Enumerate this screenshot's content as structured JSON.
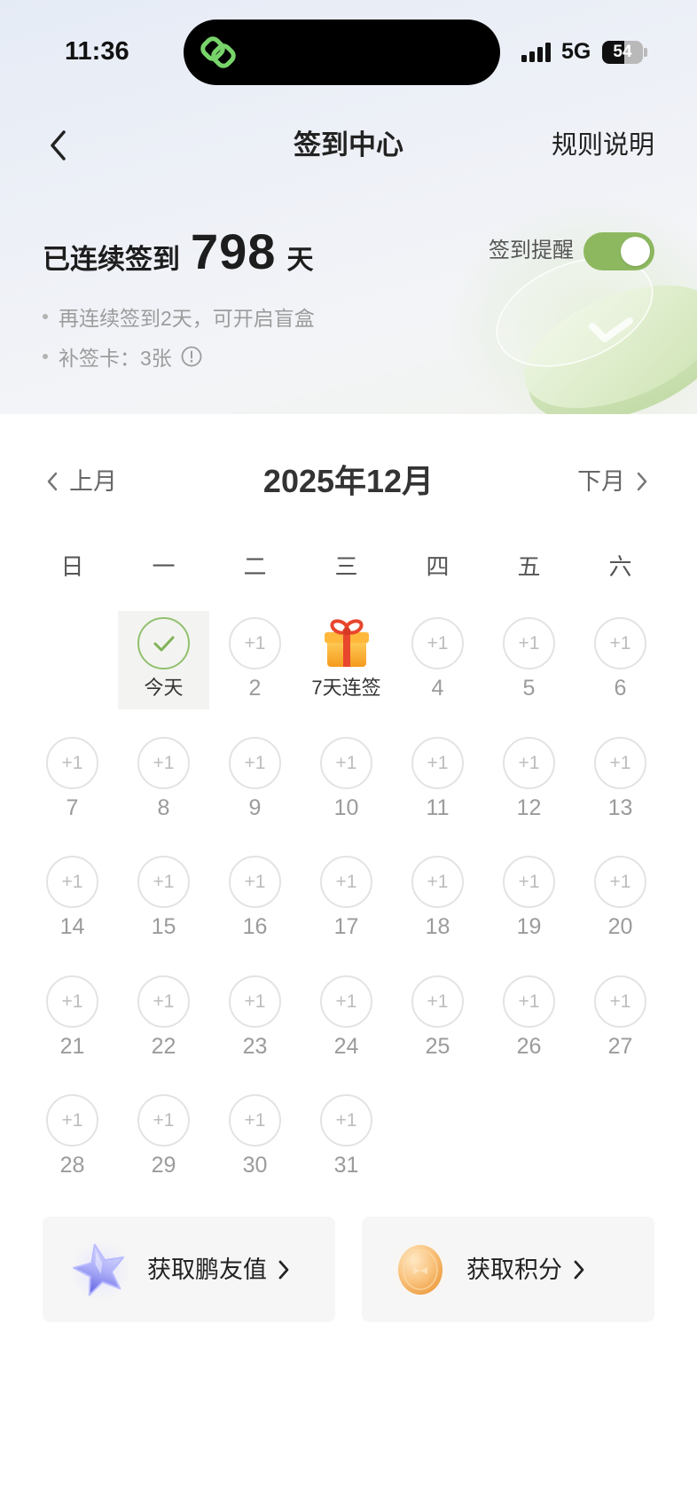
{
  "status_bar": {
    "time": "11:36",
    "island_icon": "link-icon",
    "signal_icon": "signal-icon",
    "network": "5G",
    "battery": "54"
  },
  "header": {
    "back_icon": "chevron-left-icon",
    "title": "签到中心",
    "rules_label": "规则说明"
  },
  "streak": {
    "prefix": "已连续签到",
    "days": "798",
    "suffix": "天"
  },
  "reminder": {
    "label": "签到提醒",
    "enabled": true
  },
  "tips": [
    {
      "text": "再连续签到2天，可开启盲盒"
    },
    {
      "text": "补签卡：3张",
      "icon": "info-icon"
    }
  ],
  "calendar": {
    "prev_label": "上月",
    "title": "2025年12月",
    "next_label": "下月",
    "weekdays": [
      "日",
      "一",
      "二",
      "三",
      "四",
      "五",
      "六"
    ],
    "weeks": [
      [
        null,
        {
          "label": "今天",
          "today": true,
          "signed": true,
          "icon": "check-icon"
        },
        {
          "label": "2",
          "reward": "+1"
        },
        {
          "label": "7天连签",
          "icon": "gift-icon"
        },
        {
          "label": "4",
          "reward": "+1"
        },
        {
          "label": "5",
          "reward": "+1"
        },
        {
          "label": "6",
          "reward": "+1"
        }
      ],
      [
        {
          "label": "7",
          "reward": "+1"
        },
        {
          "label": "8",
          "reward": "+1"
        },
        {
          "label": "9",
          "reward": "+1"
        },
        {
          "label": "10",
          "reward": "+1"
        },
        {
          "label": "11",
          "reward": "+1"
        },
        {
          "label": "12",
          "reward": "+1"
        },
        {
          "label": "13",
          "reward": "+1"
        }
      ],
      [
        {
          "label": "14",
          "reward": "+1"
        },
        {
          "label": "15",
          "reward": "+1"
        },
        {
          "label": "16",
          "reward": "+1"
        },
        {
          "label": "17",
          "reward": "+1"
        },
        {
          "label": "18",
          "reward": "+1"
        },
        {
          "label": "19",
          "reward": "+1"
        },
        {
          "label": "20",
          "reward": "+1"
        }
      ],
      [
        {
          "label": "21",
          "reward": "+1"
        },
        {
          "label": "22",
          "reward": "+1"
        },
        {
          "label": "23",
          "reward": "+1"
        },
        {
          "label": "24",
          "reward": "+1"
        },
        {
          "label": "25",
          "reward": "+1"
        },
        {
          "label": "26",
          "reward": "+1"
        },
        {
          "label": "27",
          "reward": "+1"
        }
      ],
      [
        {
          "label": "28",
          "reward": "+1"
        },
        {
          "label": "29",
          "reward": "+1"
        },
        {
          "label": "30",
          "reward": "+1"
        },
        {
          "label": "31",
          "reward": "+1"
        },
        null,
        null,
        null
      ]
    ]
  },
  "cards": [
    {
      "label": "获取鹏友值",
      "icon": "star-icon"
    },
    {
      "label": "获取积分",
      "icon": "coin-icon"
    }
  ],
  "colors": {
    "accent": "#8db85f",
    "check": "#7fb357",
    "card_bg": "#f6f6f6",
    "muted_text": "#9c9c9c",
    "battery_fill": "#111111",
    "battery_empty": "#b9b9b9"
  }
}
